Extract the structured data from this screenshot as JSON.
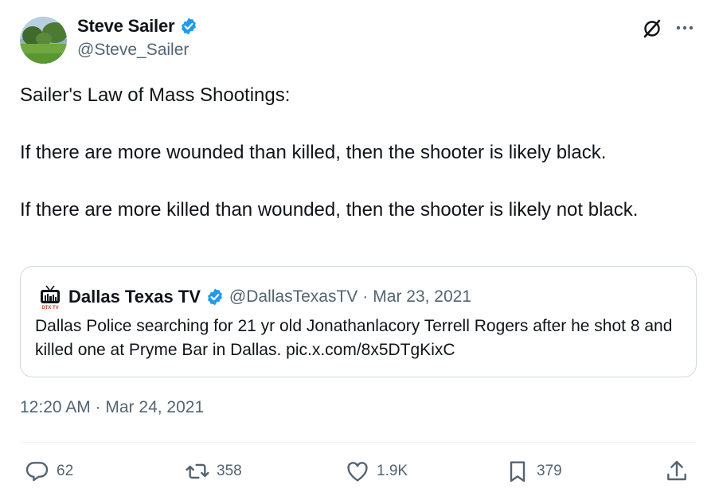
{
  "author": {
    "name": "Steve Sailer",
    "handle": "@Steve_Sailer",
    "verified_color": "#1d9bf0"
  },
  "tweet": {
    "lines": [
      "Sailer's Law of Mass Shootings:",
      "If there are more wounded than killed, then the shooter is likely black.",
      "If there are more killed than wounded, then the shooter is likely not black."
    ],
    "timestamp": "12:20 AM · Mar 24, 2021"
  },
  "quote": {
    "name": "Dallas Texas TV",
    "handle": "@DallasTexasTV",
    "separator": "·",
    "date": "Mar 23, 2021",
    "text": "Dallas Police searching for 21 yr old Jonathanlacory Terrell Rogers after he shot 8 and killed one at Pryme Bar in Dallas. pic.x.com/8x5DTgKixC",
    "logo_text": "DTX TV"
  },
  "actions": {
    "replies": "62",
    "reposts": "358",
    "likes": "1.9K",
    "bookmarks": "379"
  },
  "colors": {
    "text": "#0f1419",
    "secondary": "#536471",
    "border": "#cfd9de",
    "accent": "#1d9bf0"
  },
  "icons": [
    "verified-badge-icon",
    "grok-icon",
    "more-icon",
    "reply-icon",
    "repost-icon",
    "like-icon",
    "bookmark-icon",
    "share-icon"
  ]
}
